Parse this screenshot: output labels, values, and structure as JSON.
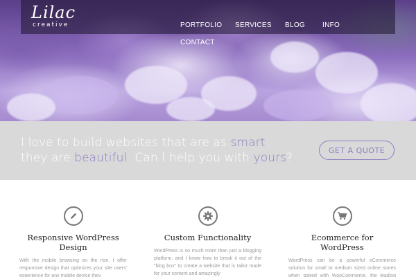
{
  "logo": {
    "main": "Lilac",
    "sub": "creative"
  },
  "nav": {
    "items": [
      {
        "label": "PORTFOLIO"
      },
      {
        "label": "SERVICES"
      },
      {
        "label": "BLOG"
      },
      {
        "label": "INFO"
      },
      {
        "label": "CONTACT"
      }
    ]
  },
  "tagline": {
    "part1": "I love to build websites that are as ",
    "smart": "smart",
    "part2": "they are ",
    "beautiful": "beautiful",
    "part3": ". Can I help you with ",
    "yours": "yours",
    "part4": "?",
    "button": "GET A QUOTE"
  },
  "features": [
    {
      "icon": "pencil-icon",
      "title": "Responsive WordPress Design",
      "text": "With the mobile browsing on the rise, I offer responsive design that optimizes your site users' experience for any mobile device they"
    },
    {
      "icon": "gear-icon",
      "title": "Custom Functionality",
      "text": "WordPress is so much more than just a blogging platform, and I know how to break it out of the \"blog box\" to create a website that is tailor made for your content and amazingly"
    },
    {
      "icon": "cart-icon",
      "title": "Ecommerce for WordPress",
      "text": "WordPress can be a powerful eCommerce solution for small to medium sized online stores when paired with WooCommerce, the leading eCommerce plugin for WordPress. In"
    }
  ],
  "colors": {
    "accent": "#8e7cc3",
    "band": "#d9d9d9",
    "nav_bg": "#1e142d"
  }
}
